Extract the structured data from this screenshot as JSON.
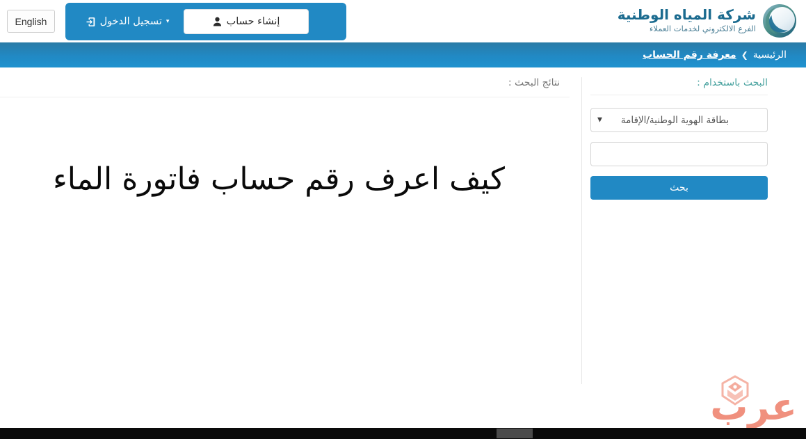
{
  "header": {
    "logo": {
      "title": "شركة المياه الوطنية",
      "subtitle": "الفرع الالكتروني لخدمات العملاء",
      "icon": "water-swirl-logo-icon",
      "title_color": "#1b6b8f",
      "subtitle_color": "#4b7f96"
    },
    "language_button": "English",
    "login_label": "تسجيل الدخول",
    "login_caret": "▾",
    "login_icon": "sign-in-icon",
    "create_account_label": "إنشاء حساب",
    "create_account_icon": "user-icon",
    "auth_group_color": "#2189c4"
  },
  "breadcrumb": {
    "home": "الرئيسية",
    "separator": "❯",
    "current": "معرفة رقم الحساب",
    "bar_color": "#2189c4"
  },
  "search_panel": {
    "title": "البحث باستخدام :",
    "title_color": "#4aa3a0",
    "select": {
      "selected": "بطاقة الهوية الوطنية/الإقامة",
      "caret": "▼",
      "options": [
        "بطاقة الهوية الوطنية/الإقامة"
      ]
    },
    "input": {
      "value": "",
      "placeholder": ""
    },
    "search_button": "بحث",
    "button_color": "#2189c4"
  },
  "results_panel": {
    "title": "نتائج البحث :",
    "headline": "كيف اعرف رقم حساب فاتورة الماء"
  },
  "watermark": {
    "text": "عرب",
    "color": "#f0907e",
    "icon": "arabic-emblem-icon"
  },
  "scrollbar": {
    "orientation": "horizontal",
    "track_color": "#0a0a0a",
    "thumb_color": "#4b4b4b"
  }
}
